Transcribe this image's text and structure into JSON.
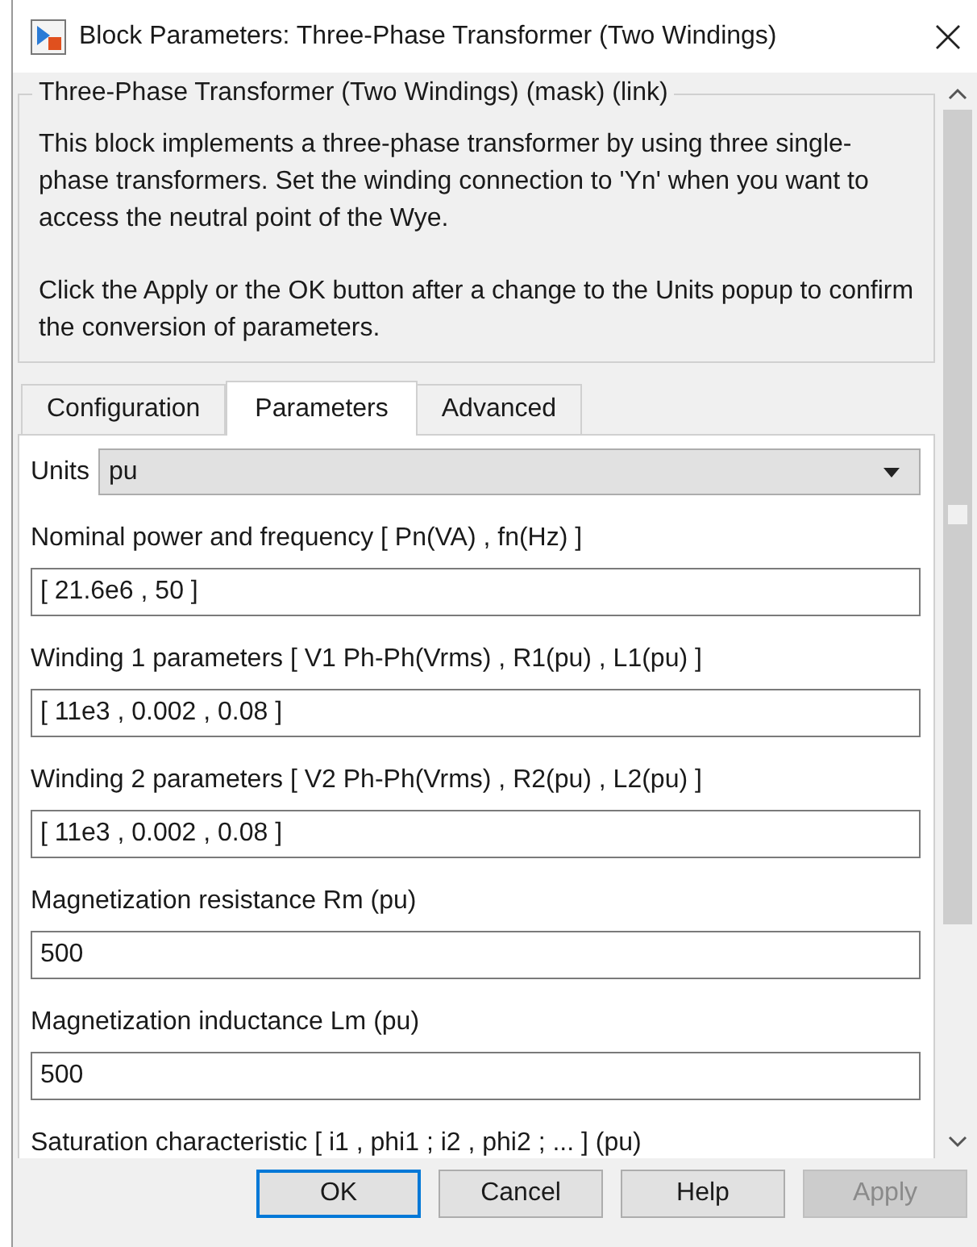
{
  "window": {
    "title": "Block Parameters: Three-Phase Transformer (Two Windings)"
  },
  "description": {
    "title": "Three-Phase Transformer (Two Windings) (mask) (link)",
    "paragraphs": [
      "This block implements a three-phase transformer by using three single-phase transformers. Set the winding connection to 'Yn' when you want to access the neutral point of the Wye.",
      "Click the Apply or the OK button after a change to the Units popup to confirm the conversion of parameters."
    ]
  },
  "tabs": [
    {
      "label": "Configuration",
      "selected": false
    },
    {
      "label": "Parameters",
      "selected": true
    },
    {
      "label": "Advanced",
      "selected": false
    }
  ],
  "units": {
    "label": "Units",
    "value": "pu"
  },
  "parameters": [
    {
      "label": "Nominal power and frequency  [ Pn(VA) , fn(Hz) ]",
      "value": "[ 21.6e6 , 50 ]"
    },
    {
      "label": "Winding 1 parameters [ V1 Ph-Ph(Vrms) , R1(pu) , L1(pu) ]",
      "value": "[ 11e3 , 0.002 , 0.08 ]"
    },
    {
      "label": "Winding 2 parameters [ V2 Ph-Ph(Vrms) , R2(pu) , L2(pu) ]",
      "value": "[ 11e3 , 0.002 , 0.08 ]"
    },
    {
      "label": "Magnetization resistance  Rm (pu)",
      "value": "500"
    },
    {
      "label": "Magnetization inductance  Lm (pu)",
      "value": "500"
    }
  ],
  "partial_label": "Saturation characteristic [ i1 , phi1 ; i2 , phi2 ; ... ] (pu)",
  "buttons": [
    {
      "label": "OK",
      "focused": true,
      "disabled": false
    },
    {
      "label": "Cancel",
      "focused": false,
      "disabled": false
    },
    {
      "label": "Help",
      "focused": false,
      "disabled": false
    },
    {
      "label": "Apply",
      "focused": false,
      "disabled": true
    }
  ]
}
